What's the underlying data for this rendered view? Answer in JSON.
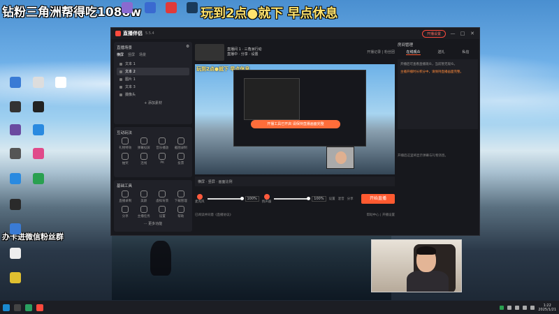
{
  "overlay": {
    "top_left": "钻粉三角洲帮得吃1088w",
    "top_center": "玩到2点●就下 早点休息",
    "mid_left": "办卡进微信粉丝群"
  },
  "app": {
    "name": "直播伴侣",
    "version": "5.5.4",
    "live_status": "开播设置",
    "window_controls": [
      "—",
      "□",
      "✕"
    ]
  },
  "left_panel": {
    "scenes_title": "直播场景",
    "scene_tabs": [
      "横屏",
      "竖屏",
      "场景"
    ],
    "sources": [
      "文本 1",
      "文本 2",
      "图片 1",
      "文本 3",
      "摄像头"
    ],
    "add_source": "+ 添加素材",
    "interaction_title": "互动玩法",
    "interaction_tools": [
      "礼物特效",
      "弹幕投屏",
      "音乐播放",
      "截图录制",
      "抽奖",
      "连线",
      "PK",
      "投票"
    ],
    "base_title": "基础工具",
    "base_tools": [
      "直播录制",
      "美颜",
      "虚拟背景",
      "下载管理",
      "分享",
      "主播任务",
      "设置",
      "帮助"
    ],
    "more_tools": "··· 更多功能"
  },
  "center": {
    "room_title": "直播间 1  ·  三角洲行动",
    "room_sub": "直播中 · 分享 · 设置",
    "room_right": "开播记录  |  粉丝团",
    "preview_title_1": "玩到2点●就下 早点休息",
    "preview_notice": "开播工具已开启  请保持直播画面完整",
    "controls": "横屏  ·  竖屏  ·  画面比例",
    "mixer": {
      "mic_label": "麦克风",
      "mic_pct": "100%",
      "speaker_label": "扬声器",
      "speaker_pct": "100%",
      "btn_labels": [
        "设置",
        "混音",
        "分享"
      ]
    },
    "start_button": "开始直播",
    "agree_text": "已阅读并同意《直播协议》",
    "footer_links": "帮助中心 | 开播设置"
  },
  "right_panel": {
    "head": "房间管理",
    "tabs": [
      "在线观众",
      "送礼",
      "私信"
    ],
    "body_text": "开播后可查看直播观众，当前暂无观众。",
    "orange_text": "主播开播时长积分中，请保持直播画面完整。",
    "chat_text": "开播后这里将显示弹幕与礼物消息。"
  },
  "taskbar": {
    "time": "1:22",
    "date": "2025/1/21"
  }
}
